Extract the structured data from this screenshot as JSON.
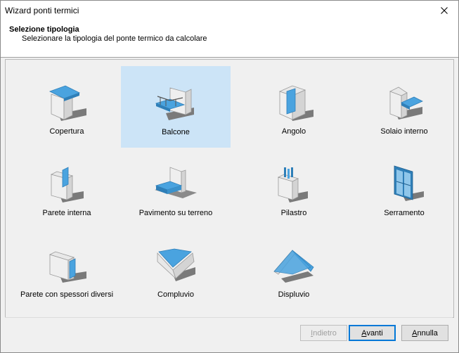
{
  "window": {
    "title": "Wizard ponti termici",
    "close_glyph": "✕"
  },
  "header": {
    "title": "Selezione tipologia",
    "subtitle": "Selezionare la tipologia del ponte termico da calcolare"
  },
  "tiles": [
    {
      "label": "Copertura",
      "icon": "copertura-icon"
    },
    {
      "label": "Balcone",
      "icon": "balcone-icon",
      "selected": true
    },
    {
      "label": "Angolo",
      "icon": "angolo-icon"
    },
    {
      "label": "Solaio interno",
      "icon": "solaio-interno-icon"
    },
    {
      "label": "Parete interna",
      "icon": "parete-interna-icon"
    },
    {
      "label": "Pavimento su terreno",
      "icon": "pavimento-su-terreno-icon"
    },
    {
      "label": "Pilastro",
      "icon": "pilastro-icon"
    },
    {
      "label": "Serramento",
      "icon": "serramento-icon"
    },
    {
      "label": "Parete con spessori diversi",
      "icon": "parete-spessori-diversi-icon"
    },
    {
      "label": "Compluvio",
      "icon": "compluvio-icon"
    },
    {
      "label": "Displuvio",
      "icon": "displuvio-icon"
    }
  ],
  "buttons": {
    "back": {
      "first": "I",
      "rest": "ndietro",
      "enabled": false
    },
    "next": {
      "first": "A",
      "rest": "vanti",
      "default": true
    },
    "cancel": {
      "first": "A",
      "rest": "nnulla"
    }
  },
  "colors": {
    "accent_blue": "#4aa3df",
    "selection": "#cce4f7",
    "focus_border": "#0078d7"
  }
}
